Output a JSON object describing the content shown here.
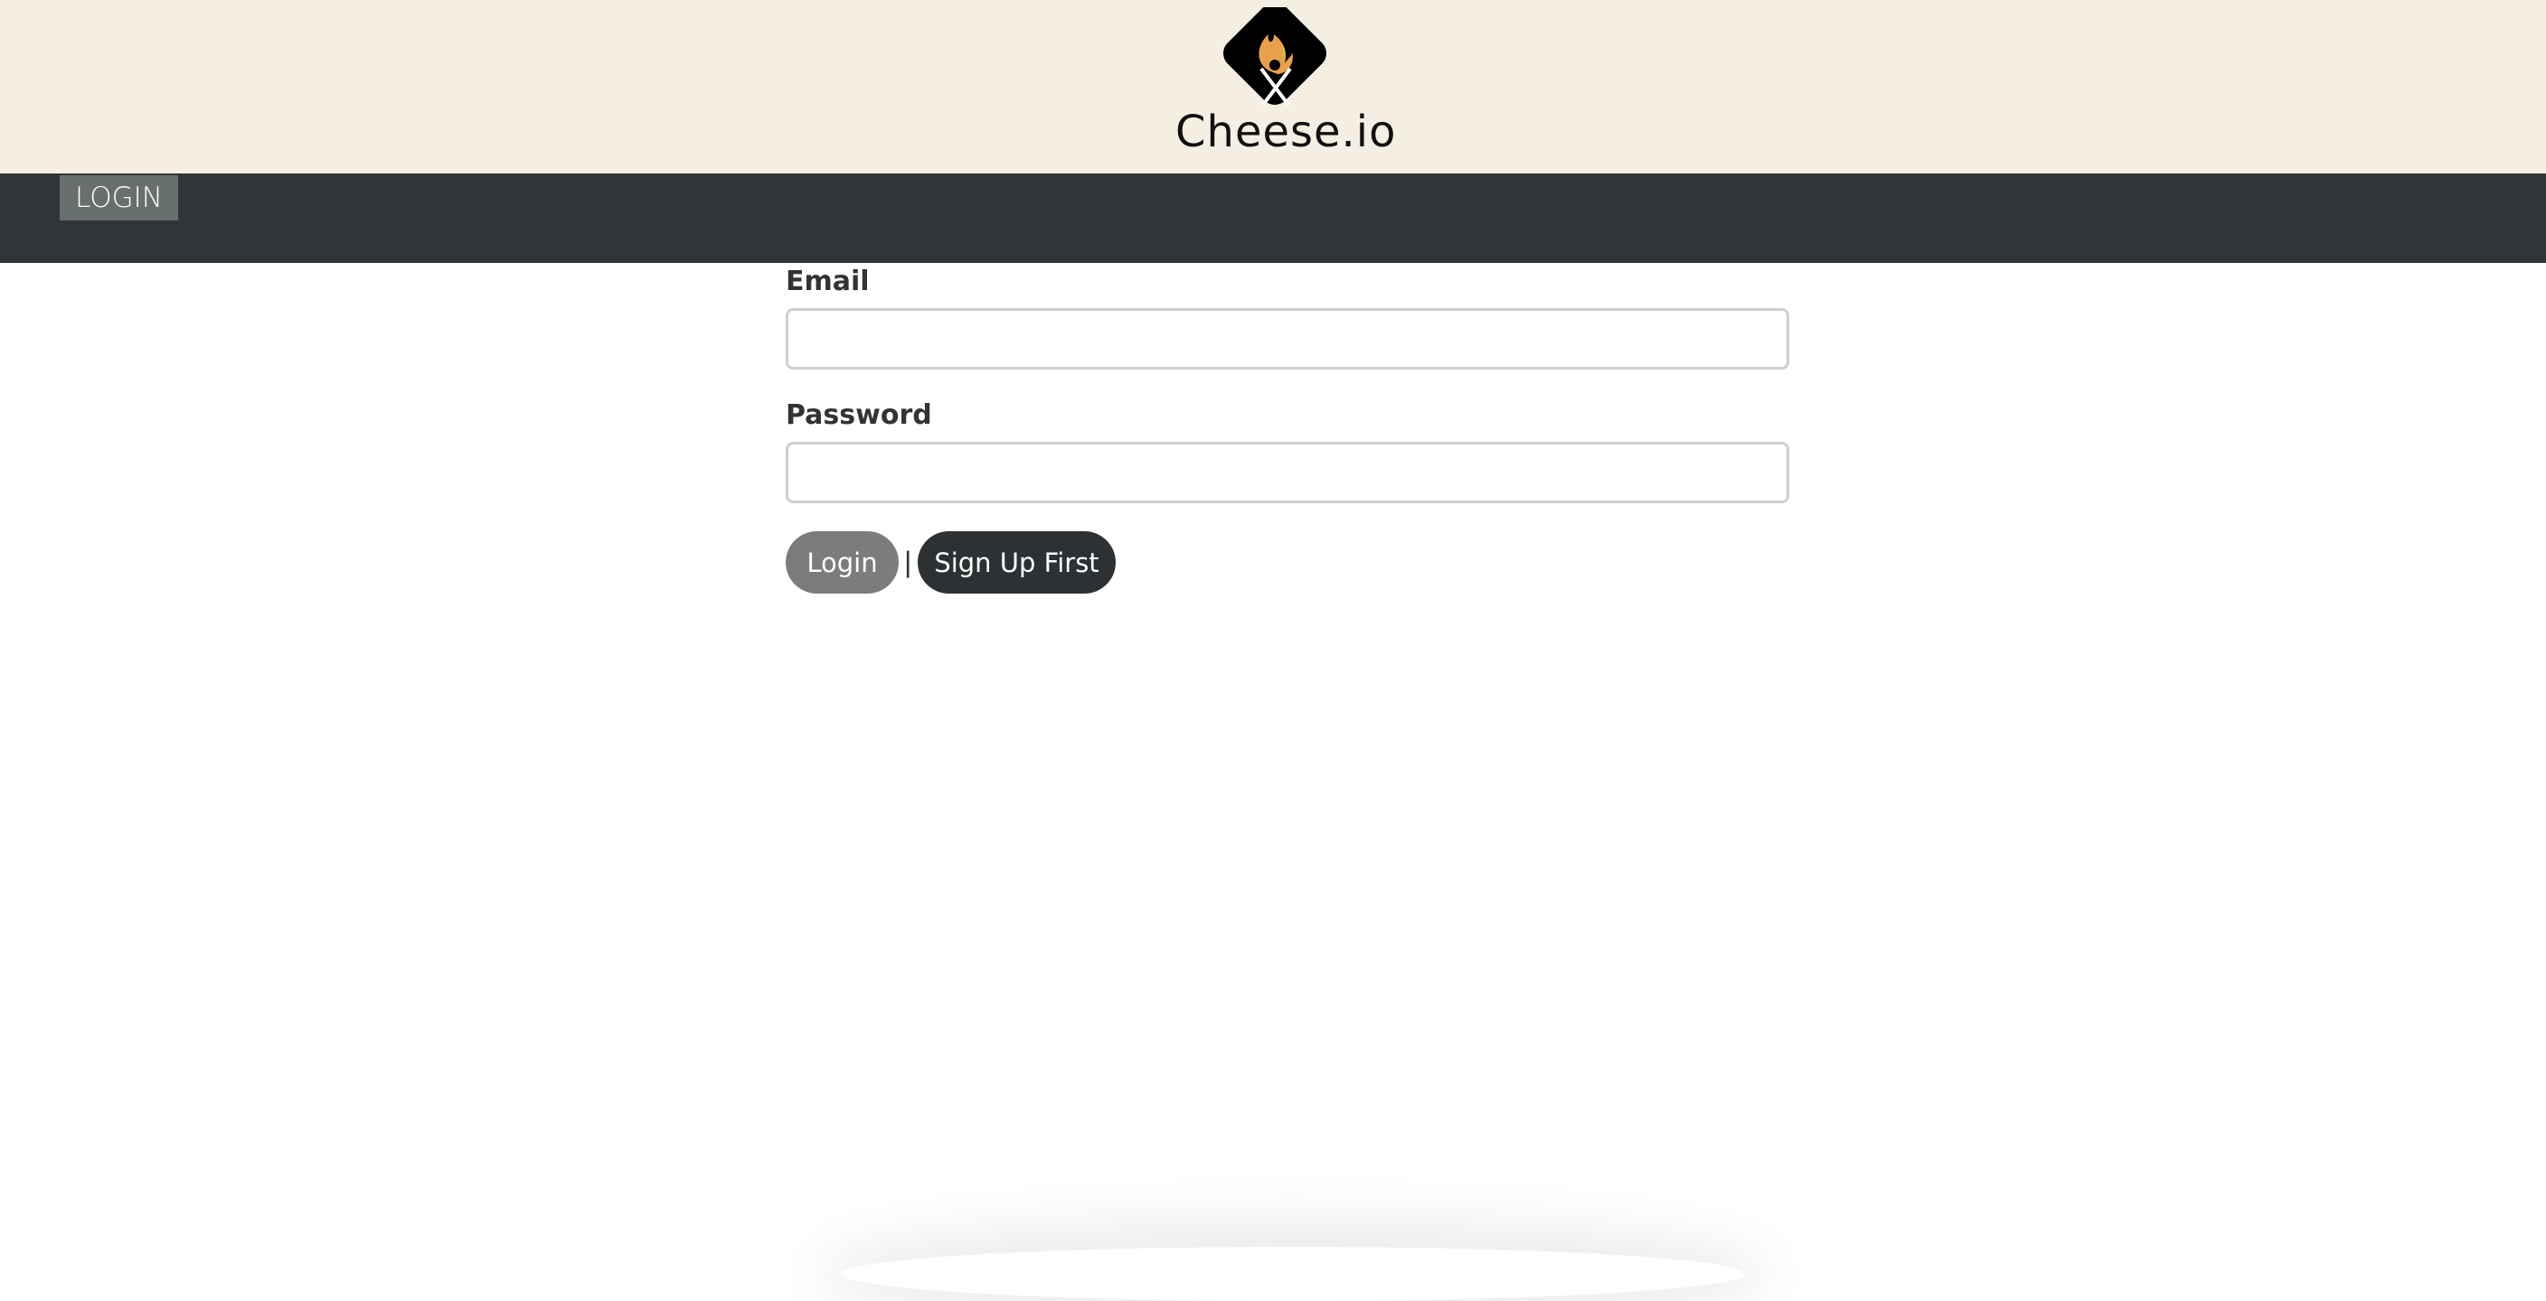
{
  "header": {
    "brand": "Cheese.io",
    "logo_icon": "flame-fork-knife-logo"
  },
  "nav": {
    "login_tab": "LOGIN"
  },
  "form": {
    "email_label": "Email",
    "email_value": "",
    "password_label": "Password",
    "password_value": "",
    "login_button": "Login",
    "separator": "|",
    "signup_button": "Sign Up First"
  },
  "colors": {
    "header_bg": "#f5efe3",
    "nav_bg": "#313538",
    "login_btn": "#7a7d7c",
    "signup_btn": "#2d3133"
  }
}
